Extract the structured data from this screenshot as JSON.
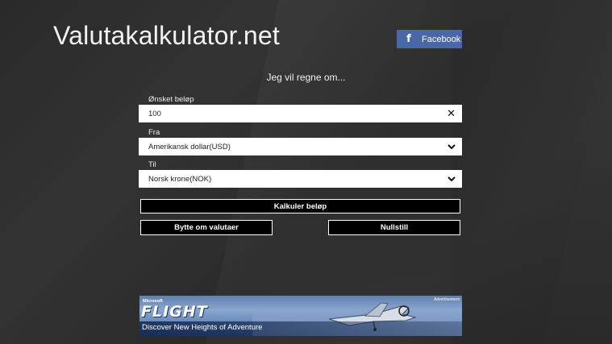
{
  "app": {
    "title": "Valutakalkulator.net"
  },
  "facebook": {
    "icon": "facebook-icon",
    "glyph": "f",
    "label": "Facebook",
    "color": "#4a67a8"
  },
  "form": {
    "heading": "Jeg vil regne om...",
    "amount": {
      "label": "Ønsket beløp",
      "value": "100",
      "clear_icon": "close-icon",
      "clear_glyph": "✕"
    },
    "from": {
      "label": "Fra",
      "selected": "Amerikansk dollar(USD)",
      "icon": "chevron-down-icon",
      "glyph": "⌄"
    },
    "to": {
      "label": "Til",
      "selected": "Norsk krone(NOK)",
      "icon": "chevron-down-icon",
      "glyph": "⌄"
    }
  },
  "buttons": {
    "calculate": "Kalkuler beløp",
    "swap": "Bytte om valutaer",
    "reset": "Nullstill"
  },
  "ad": {
    "tag": "Advertisement",
    "brand": "Microsoft",
    "logo": "FLIGHT",
    "tagline": "Discover New Heights of Adventure"
  }
}
